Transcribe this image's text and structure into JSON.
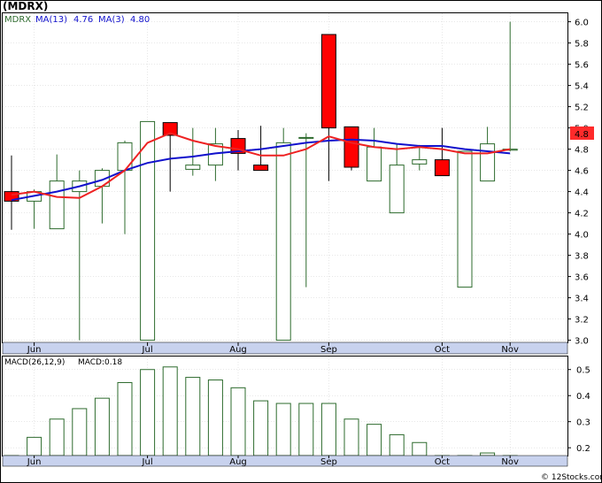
{
  "header": {
    "title": "(MDRX)",
    "legend": {
      "symbol": "MDRX",
      "ma13_label": "MA(13)",
      "ma13_value": "4.76",
      "ma3_label": "MA(3)",
      "ma3_value": "4.80"
    },
    "macd_legend": {
      "label": "MACD(26,12,9)",
      "value_label": "MACD:0.18"
    }
  },
  "price_tag": "4.8",
  "watermark": "© 12Stocks.com",
  "colors": {
    "up": "#2e6b2e",
    "down": "#ff0000",
    "ma13": "#1111cc",
    "ma3": "#ee2222",
    "axis_bar": "#c8d2ee",
    "grid": "#cfcfcf",
    "price_tag_bg": "#ff2b2b"
  },
  "chart_data": [
    {
      "type": "candlestick",
      "title": "(MDRX)",
      "period": "weekly",
      "x_month_labels": [
        {
          "label": "Jun",
          "week": 1
        },
        {
          "label": "Jul",
          "week": 6
        },
        {
          "label": "Aug",
          "week": 10
        },
        {
          "label": "Sep",
          "week": 14
        },
        {
          "label": "Oct",
          "week": 19
        },
        {
          "label": "Nov",
          "week": 22
        }
      ],
      "y_ticks": [
        3.0,
        3.2,
        3.4,
        3.6,
        3.8,
        4.0,
        4.2,
        4.4,
        4.6,
        4.8,
        5.0,
        5.2,
        5.4,
        5.6,
        5.8,
        6.0
      ],
      "ylim": [
        2.98,
        6.08
      ],
      "candles": [
        {
          "o": 4.4,
          "h": 4.74,
          "l": 4.04,
          "c": 4.31
        },
        {
          "o": 4.31,
          "h": 4.42,
          "l": 4.05,
          "c": 4.4
        },
        {
          "o": 4.05,
          "h": 4.75,
          "l": 4.05,
          "c": 4.5
        },
        {
          "o": 4.4,
          "h": 4.6,
          "l": 3.0,
          "c": 4.5
        },
        {
          "o": 4.45,
          "h": 4.62,
          "l": 4.1,
          "c": 4.6
        },
        {
          "o": 4.6,
          "h": 4.88,
          "l": 4.0,
          "c": 4.86
        },
        {
          "o": 3.0,
          "h": 5.06,
          "l": 3.0,
          "c": 5.06
        },
        {
          "o": 5.05,
          "h": 5.02,
          "l": 4.4,
          "c": 4.93
        },
        {
          "o": 4.61,
          "h": 5.0,
          "l": 4.55,
          "c": 4.65
        },
        {
          "o": 4.65,
          "h": 5.0,
          "l": 4.5,
          "c": 4.85
        },
        {
          "o": 4.9,
          "h": 4.98,
          "l": 4.6,
          "c": 4.76
        },
        {
          "o": 4.65,
          "h": 5.02,
          "l": 4.6,
          "c": 4.6
        },
        {
          "o": 3.0,
          "h": 5.0,
          "l": 3.0,
          "c": 4.86
        },
        {
          "o": 4.91,
          "h": 4.95,
          "l": 3.5,
          "c": 4.91
        },
        {
          "o": 5.88,
          "h": 5.88,
          "l": 4.5,
          "c": 5.0
        },
        {
          "o": 5.01,
          "h": 5.01,
          "l": 4.6,
          "c": 4.63
        },
        {
          "o": 4.5,
          "h": 5.0,
          "l": 4.5,
          "c": 4.82
        },
        {
          "o": 4.2,
          "h": 4.85,
          "l": 4.2,
          "c": 4.65
        },
        {
          "o": 4.66,
          "h": 4.84,
          "l": 4.6,
          "c": 4.7
        },
        {
          "o": 4.7,
          "h": 5.0,
          "l": 4.55,
          "c": 4.55
        },
        {
          "o": 3.5,
          "h": 4.78,
          "l": 3.5,
          "c": 4.78
        },
        {
          "o": 4.5,
          "h": 5.01,
          "l": 4.5,
          "c": 4.85
        },
        {
          "o": 4.79,
          "h": 6.0,
          "l": 4.78,
          "c": 4.8
        }
      ],
      "series": [
        {
          "name": "MA(13)",
          "values": [
            4.32,
            4.36,
            4.4,
            4.45,
            4.51,
            4.6,
            4.67,
            4.71,
            4.73,
            4.76,
            4.78,
            4.8,
            4.83,
            4.86,
            4.88,
            4.89,
            4.88,
            4.85,
            4.83,
            4.83,
            4.8,
            4.78,
            4.76
          ]
        },
        {
          "name": "MA(3)",
          "values": [
            4.37,
            4.4,
            4.35,
            4.34,
            4.45,
            4.6,
            4.86,
            4.95,
            4.88,
            4.83,
            4.8,
            4.74,
            4.74,
            4.8,
            4.92,
            4.86,
            4.82,
            4.8,
            4.82,
            4.8,
            4.76,
            4.76,
            4.8
          ]
        }
      ]
    },
    {
      "type": "bar",
      "title": "MACD(26,12,9)",
      "y_ticks": [
        0.2,
        0.3,
        0.4,
        0.5
      ],
      "ylim": [
        0.17,
        0.55
      ],
      "x_month_labels": [
        {
          "label": "Jun",
          "week": 1
        },
        {
          "label": "Jul",
          "week": 6
        },
        {
          "label": "Aug",
          "week": 10
        },
        {
          "label": "Sep",
          "week": 14
        },
        {
          "label": "Oct",
          "week": 19
        },
        {
          "label": "Nov",
          "week": 22
        }
      ],
      "values": [
        0.17,
        0.24,
        0.31,
        0.35,
        0.39,
        0.45,
        0.5,
        0.51,
        0.47,
        0.46,
        0.43,
        0.38,
        0.37,
        0.37,
        0.37,
        0.31,
        0.29,
        0.25,
        0.22,
        0.17,
        0.15,
        0.18,
        0.15
      ]
    }
  ]
}
